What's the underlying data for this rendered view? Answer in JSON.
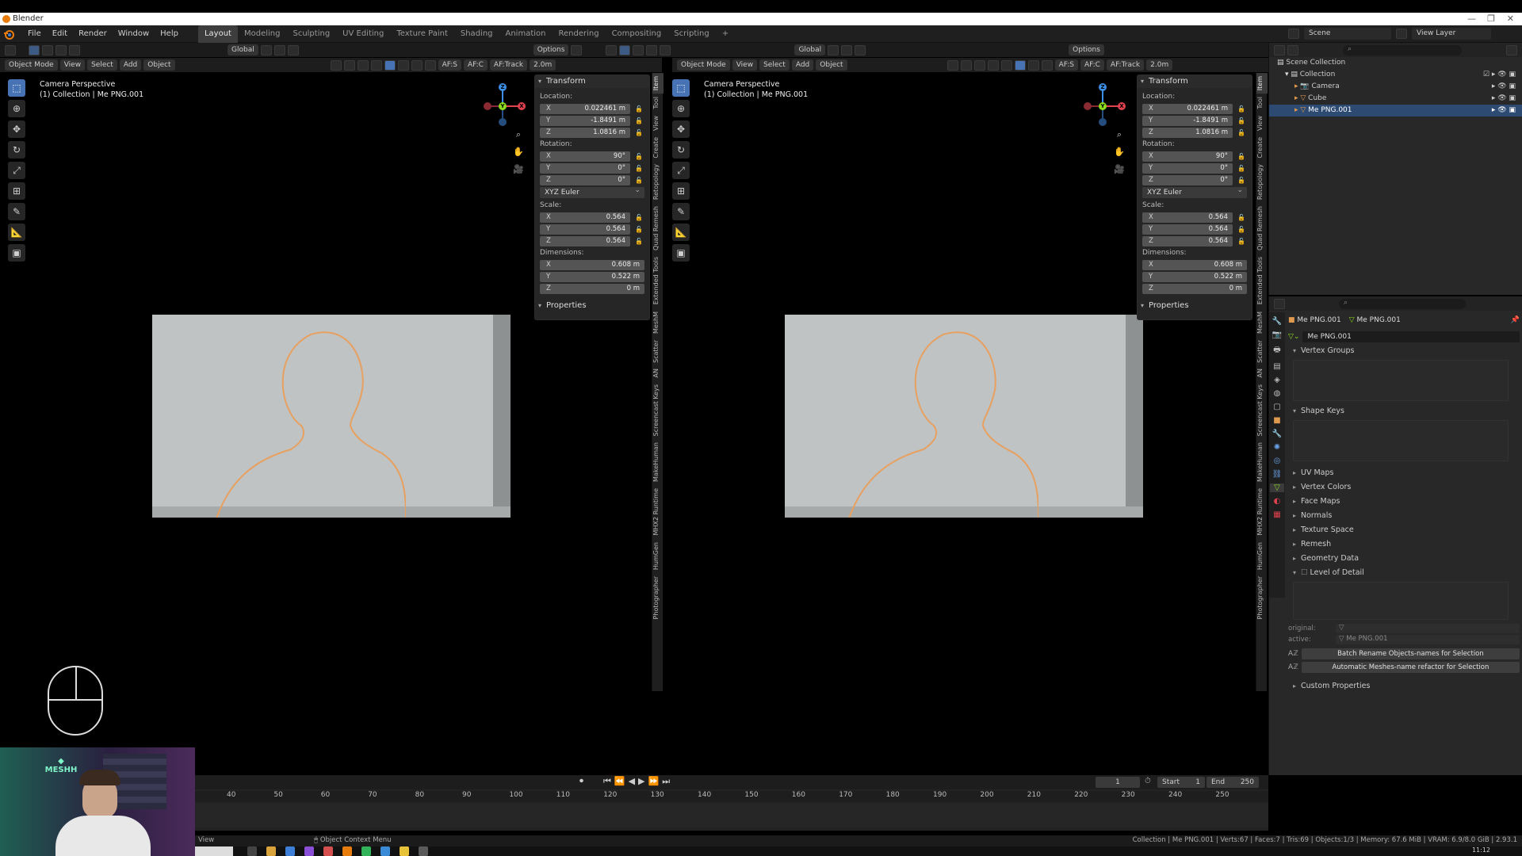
{
  "window": {
    "title": "Blender",
    "clock": "11:12"
  },
  "menus": [
    "File",
    "Edit",
    "Render",
    "Window",
    "Help"
  ],
  "workspaces": [
    "Layout",
    "Modeling",
    "Sculpting",
    "UV Editing",
    "Texture Paint",
    "Shading",
    "Animation",
    "Rendering",
    "Compositing",
    "Scripting"
  ],
  "active_workspace": "Layout",
  "scene_name": "Scene",
  "view_layer": "View Layer",
  "viewports": [
    {
      "mode": "Object Mode",
      "menus": [
        "View",
        "Select",
        "Add",
        "Object"
      ],
      "orientation": "Global",
      "options_label": "Options",
      "af_s": "AF:S",
      "af_c": "AF:C",
      "af_track": "AF:Track",
      "focal": "2.0m",
      "header_line1": "Camera Perspective",
      "header_line2": "(1) Collection | Me PNG.001"
    },
    {
      "mode": "Object Mode",
      "menus": [
        "View",
        "Select",
        "Add",
        "Object"
      ],
      "orientation": "Global",
      "options_label": "Options",
      "af_s": "AF:S",
      "af_c": "AF:C",
      "af_track": "AF:Track",
      "focal": "2.0m",
      "header_line1": "Camera Perspective",
      "header_line2": "(1) Collection | Me PNG.001"
    }
  ],
  "transform": {
    "title": "Transform",
    "location_label": "Location:",
    "location": {
      "x": "0.022461 m",
      "y": "-1.8491 m",
      "z": "1.0816 m"
    },
    "rotation_label": "Rotation:",
    "rotation": {
      "x": "90°",
      "y": "0°",
      "z": "0°"
    },
    "rotation_mode": "XYZ Euler",
    "scale_label": "Scale:",
    "scale": {
      "x": "0.564",
      "y": "0.564",
      "z": "0.564"
    },
    "dimensions_label": "Dimensions:",
    "dimensions": {
      "x": "0.608 m",
      "y": "0.522 m",
      "z": "0 m"
    },
    "properties_label": "Properties",
    "axis_labels": {
      "x": "X",
      "y": "Y",
      "z": "Z"
    }
  },
  "npanel_tabs": [
    "Item",
    "Tool",
    "View",
    "Create",
    "Retopology",
    "Quad Remesh",
    "Extended Tools",
    "MeshM",
    "Scatter",
    "AN",
    "Screencast Keys",
    "MakeHuman",
    "MHX2 Runtime",
    "HumGen",
    "Photographer"
  ],
  "outliner": {
    "root": "Scene Collection",
    "items": [
      {
        "label": "Collection",
        "indent": 0
      },
      {
        "label": "Camera",
        "indent": 1
      },
      {
        "label": "Cube",
        "indent": 1
      },
      {
        "label": "Me PNG.001",
        "indent": 1,
        "selected": true
      }
    ]
  },
  "properties": {
    "object_name": "Me PNG.001",
    "data_name": "Me PNG.001",
    "mesh_field": "Me PNG.001",
    "sections": [
      "Vertex Groups",
      "Shape Keys",
      "UV Maps",
      "Vertex Colors",
      "Face Maps",
      "Normals",
      "Texture Space",
      "Remesh",
      "Geometry Data",
      "Level of Detail",
      "Custom Properties"
    ],
    "lod_original_label": "original:",
    "lod_active_label": "active:",
    "lod_active_value": "Me PNG.001",
    "batch_rename": "Batch Rename Objects-names for Selection",
    "auto_rename": "Automatic Meshes-name refactor for Selection"
  },
  "timeline": {
    "current_frame": "1",
    "start_label": "Start",
    "start": "1",
    "end_label": "End",
    "end": "250",
    "ticks": [
      "40",
      "50",
      "60",
      "70",
      "80",
      "90",
      "100",
      "110",
      "120",
      "130",
      "140",
      "150",
      "160",
      "170",
      "180",
      "190",
      "200",
      "210",
      "220",
      "230",
      "240",
      "250"
    ]
  },
  "statusbar": {
    "left": "View",
    "context": "Object Context Menu",
    "right": "Collection | Me PNG.001 | Verts:67 | Faces:7 | Tris:69 | Objects:1/3 | Memory: 67.6 MiB | VRAM: 6.9/8.0 GiB | 2.93.1"
  },
  "webcam": {
    "logo": "MESHH"
  },
  "colors": {
    "accent": "#4772b3",
    "outline_orange": "#e8a060",
    "x_axis": "#e0414e",
    "y_axis": "#8bdc1f",
    "z_axis": "#3c8fe6"
  }
}
